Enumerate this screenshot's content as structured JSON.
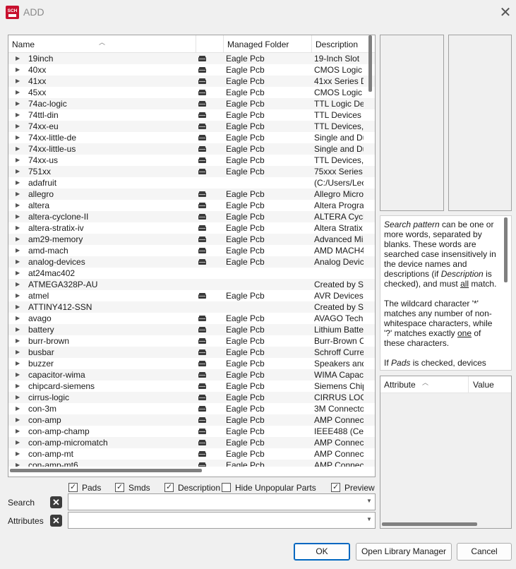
{
  "window": {
    "title": "ADD",
    "app_icon_text": "SCH"
  },
  "tree": {
    "columns": [
      "Name",
      "",
      "Managed Folder",
      "Description"
    ],
    "rows": [
      {
        "name": "19inch",
        "lock": true,
        "folder": "Eagle Pcb",
        "desc": "19-Inch Slot"
      },
      {
        "name": "40xx",
        "lock": true,
        "folder": "Eagle Pcb",
        "desc": "CMOS Logic I"
      },
      {
        "name": "41xx",
        "lock": true,
        "folder": "Eagle Pcb",
        "desc": "41xx Series D"
      },
      {
        "name": "45xx",
        "lock": true,
        "folder": "Eagle Pcb",
        "desc": "CMOS Logic I"
      },
      {
        "name": "74ac-logic",
        "lock": true,
        "folder": "Eagle Pcb",
        "desc": "TTL Logic De"
      },
      {
        "name": "74ttl-din",
        "lock": true,
        "folder": "Eagle Pcb",
        "desc": "TTL Devices"
      },
      {
        "name": "74xx-eu",
        "lock": true,
        "folder": "Eagle Pcb",
        "desc": "TTL Devices,"
      },
      {
        "name": "74xx-little-de",
        "lock": true,
        "folder": "Eagle Pcb",
        "desc": "Single and Du"
      },
      {
        "name": "74xx-little-us",
        "lock": true,
        "folder": "Eagle Pcb",
        "desc": "Single and Du"
      },
      {
        "name": "74xx-us",
        "lock": true,
        "folder": "Eagle Pcb",
        "desc": "TTL Devices,"
      },
      {
        "name": "751xx",
        "lock": true,
        "folder": "Eagle Pcb",
        "desc": "75xxx Series"
      },
      {
        "name": "adafruit",
        "lock": false,
        "folder": "",
        "desc": "(C:/Users/Leo"
      },
      {
        "name": "allegro",
        "lock": true,
        "folder": "Eagle Pcb",
        "desc": "Allegro Micro"
      },
      {
        "name": "altera",
        "lock": true,
        "folder": "Eagle Pcb",
        "desc": "Altera Progra"
      },
      {
        "name": "altera-cyclone-II",
        "lock": true,
        "folder": "Eagle Pcb",
        "desc": "ALTERA Cycl"
      },
      {
        "name": "altera-stratix-iv",
        "lock": true,
        "folder": "Eagle Pcb",
        "desc": "Altera Stratix"
      },
      {
        "name": "am29-memory",
        "lock": true,
        "folder": "Eagle Pcb",
        "desc": "Advanced Mi"
      },
      {
        "name": "amd-mach",
        "lock": true,
        "folder": "Eagle Pcb",
        "desc": "AMD MACH4/"
      },
      {
        "name": "analog-devices",
        "lock": true,
        "folder": "Eagle Pcb",
        "desc": "Analog Devic"
      },
      {
        "name": "at24mac402",
        "lock": false,
        "folder": "",
        "desc": ""
      },
      {
        "name": "ATMEGA328P-AU",
        "lock": false,
        "folder": "",
        "desc": "Created by S"
      },
      {
        "name": "atmel",
        "lock": true,
        "folder": "Eagle Pcb",
        "desc": "AVR Devices"
      },
      {
        "name": "ATTINY412-SSN",
        "lock": false,
        "folder": "",
        "desc": "Created by S"
      },
      {
        "name": "avago",
        "lock": true,
        "folder": "Eagle Pcb",
        "desc": "AVAGO Tech"
      },
      {
        "name": "battery",
        "lock": true,
        "folder": "Eagle Pcb",
        "desc": "Lithium Batte"
      },
      {
        "name": "burr-brown",
        "lock": true,
        "folder": "Eagle Pcb",
        "desc": "Burr-Brown C"
      },
      {
        "name": "busbar",
        "lock": true,
        "folder": "Eagle Pcb",
        "desc": "Schroff Curre"
      },
      {
        "name": "buzzer",
        "lock": true,
        "folder": "Eagle Pcb",
        "desc": "Speakers and"
      },
      {
        "name": "capacitor-wima",
        "lock": true,
        "folder": "Eagle Pcb",
        "desc": "WIMA Capac"
      },
      {
        "name": "chipcard-siemens",
        "lock": true,
        "folder": "Eagle Pcb",
        "desc": "Siemens Chip"
      },
      {
        "name": "cirrus-logic",
        "lock": true,
        "folder": "Eagle Pcb",
        "desc": "CIRRUS LOGI"
      },
      {
        "name": "con-3m",
        "lock": true,
        "folder": "Eagle Pcb",
        "desc": "3M Connecto"
      },
      {
        "name": "con-amp",
        "lock": true,
        "folder": "Eagle Pcb",
        "desc": "AMP Connect"
      },
      {
        "name": "con-amp-champ",
        "lock": true,
        "folder": "Eagle Pcb",
        "desc": "IEEE488 (Ce"
      },
      {
        "name": "con-amp-micromatch",
        "lock": true,
        "folder": "Eagle Pcb",
        "desc": "AMP Connect"
      },
      {
        "name": "con-amp-mt",
        "lock": true,
        "folder": "Eagle Pcb",
        "desc": "AMP Connect"
      },
      {
        "name": "con-amp-mt6",
        "lock": true,
        "folder": "Eagle Pcb",
        "desc": "AMP Connect"
      }
    ]
  },
  "help": {
    "p1_em": "Search pattern",
    "p1_a": " can be one or more words, separated by blanks. These words are searched case insensitively in the device names and descriptions (if ",
    "p1_em2": "Description",
    "p1_b": " is checked), and must ",
    "p1_u": "all",
    "p1_c": " match.",
    "p2_a": "The wildcard character '*' matches any number of non-whitespace characters, while '?' matches exactly ",
    "p2_u": "one",
    "p2_b": " of these characters.",
    "p3_a": "If ",
    "p3_em": "Pads",
    "p3_b": " is checked, devices"
  },
  "attributes_table": {
    "col_attribute": "Attribute",
    "col_value": "Value"
  },
  "options": {
    "pads": "Pads",
    "smds": "Smds",
    "description": "Description",
    "hide_unpopular": "Hide Unpopular Parts",
    "preview": "Preview"
  },
  "search": {
    "label": "Search",
    "value": ""
  },
  "attributes": {
    "label": "Attributes",
    "value": ""
  },
  "buttons": {
    "ok": "OK",
    "open_library_manager": "Open Library Manager",
    "cancel": "Cancel"
  }
}
